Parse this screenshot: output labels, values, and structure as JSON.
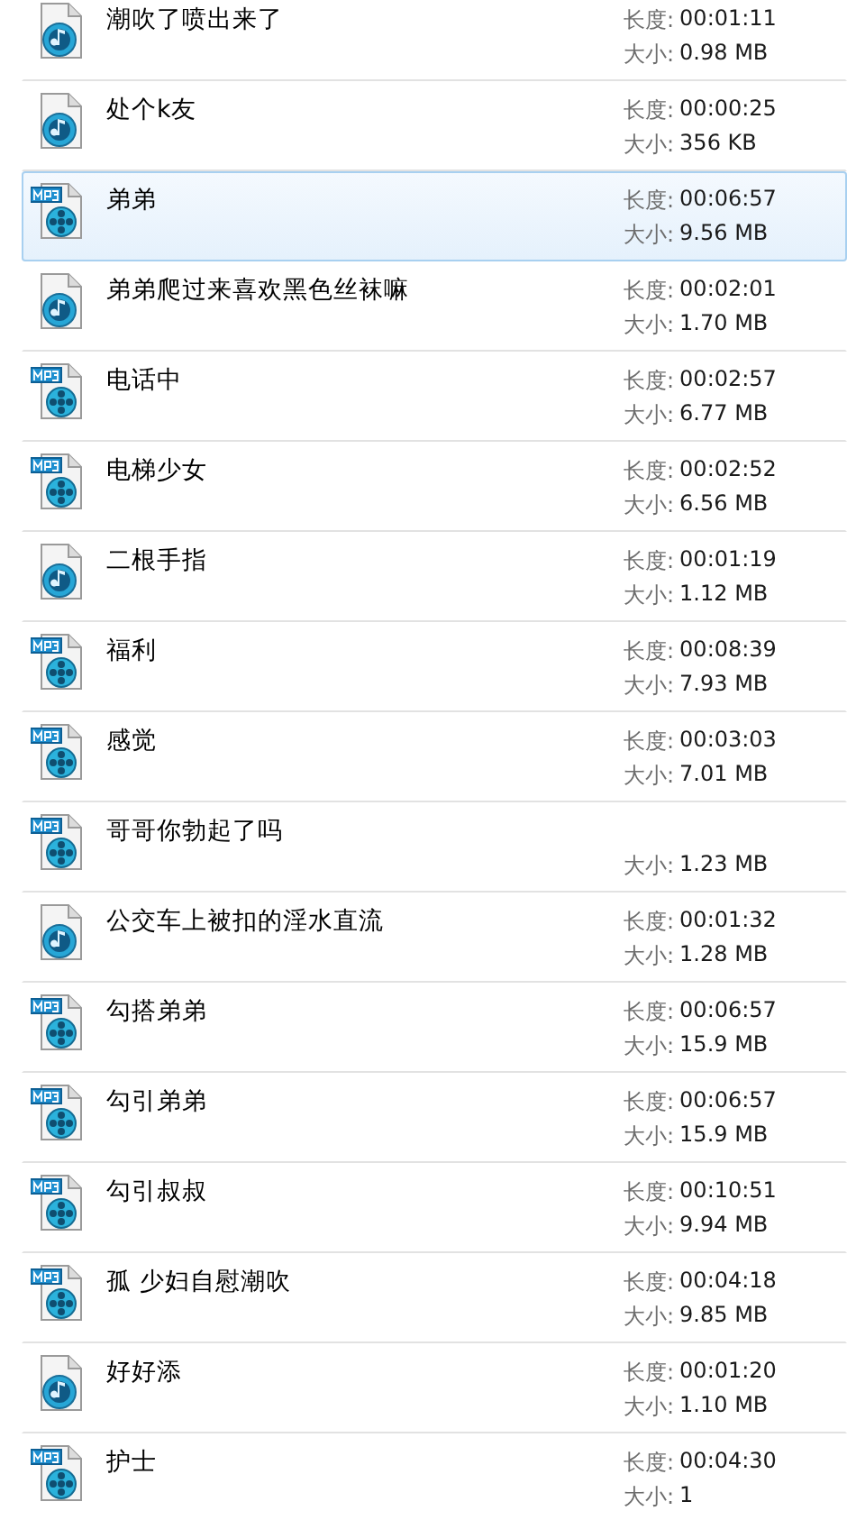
{
  "files": [
    {
      "kind": "audio",
      "name": "潮吹了喷出来了",
      "length_label": "长度:",
      "length": "00:01:11",
      "size_label": "大小:",
      "size": "0.98 MB",
      "selected": false
    },
    {
      "kind": "audio",
      "name": "处个k友",
      "length_label": "长度:",
      "length": "00:00:25",
      "size_label": "大小:",
      "size": "356 KB",
      "selected": false
    },
    {
      "kind": "mp3",
      "name": "弟弟",
      "length_label": "长度:",
      "length": "00:06:57",
      "size_label": "大小:",
      "size": "9.56 MB",
      "selected": true
    },
    {
      "kind": "audio",
      "name": "弟弟爬过来喜欢黑色丝袜嘛",
      "length_label": "长度:",
      "length": "00:02:01",
      "size_label": "大小:",
      "size": "1.70 MB",
      "selected": false
    },
    {
      "kind": "mp3",
      "name": "电话中",
      "length_label": "长度:",
      "length": "00:02:57",
      "size_label": "大小:",
      "size": "6.77 MB",
      "selected": false
    },
    {
      "kind": "mp3",
      "name": "电梯少女",
      "length_label": "长度:",
      "length": "00:02:52",
      "size_label": "大小:",
      "size": "6.56 MB",
      "selected": false
    },
    {
      "kind": "audio",
      "name": "二根手指",
      "length_label": "长度:",
      "length": "00:01:19",
      "size_label": "大小:",
      "size": "1.12 MB",
      "selected": false
    },
    {
      "kind": "mp3",
      "name": "福利",
      "length_label": "长度:",
      "length": "00:08:39",
      "size_label": "大小:",
      "size": "7.93 MB",
      "selected": false
    },
    {
      "kind": "mp3",
      "name": "感觉",
      "length_label": "长度:",
      "length": "00:03:03",
      "size_label": "大小:",
      "size": "7.01 MB",
      "selected": false
    },
    {
      "kind": "mp3",
      "name": "哥哥你勃起了吗",
      "size_label": "大小:",
      "size": "1.23 MB",
      "selected": false
    },
    {
      "kind": "audio",
      "name": "公交车上被扣的淫水直流",
      "length_label": "长度:",
      "length": "00:01:32",
      "size_label": "大小:",
      "size": "1.28 MB",
      "selected": false
    },
    {
      "kind": "mp3",
      "name": "勾搭弟弟",
      "length_label": "长度:",
      "length": "00:06:57",
      "size_label": "大小:",
      "size": "15.9 MB",
      "selected": false
    },
    {
      "kind": "mp3",
      "name": "勾引弟弟",
      "length_label": "长度:",
      "length": "00:06:57",
      "size_label": "大小:",
      "size": "15.9 MB",
      "selected": false
    },
    {
      "kind": "mp3",
      "name": "勾引叔叔",
      "length_label": "长度:",
      "length": "00:10:51",
      "size_label": "大小:",
      "size": "9.94 MB",
      "selected": false
    },
    {
      "kind": "mp3",
      "name": "孤 少妇自慰潮吹",
      "length_label": "长度:",
      "length": "00:04:18",
      "size_label": "大小:",
      "size": "9.85 MB",
      "selected": false
    },
    {
      "kind": "audio",
      "name": "好好添",
      "length_label": "长度:",
      "length": "00:01:20",
      "size_label": "大小:",
      "size": "1.10 MB",
      "selected": false
    },
    {
      "kind": "mp3",
      "name": "护士",
      "length_label": "长度:",
      "length": "00:04:30",
      "size_label": "大小:",
      "size": "1",
      "selected": false
    }
  ]
}
